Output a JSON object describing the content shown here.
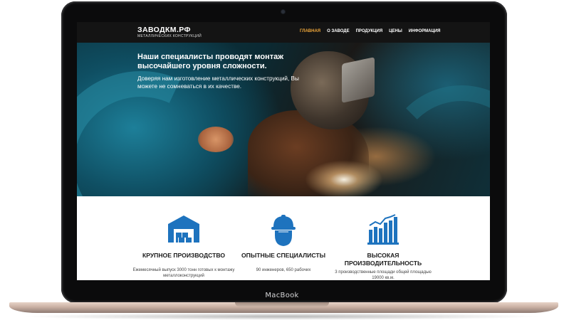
{
  "device": {
    "brand_label": "MacBook"
  },
  "nav": {
    "logo_title": "ЗАВОДКМ.РФ",
    "logo_subtitle": "МЕТАЛЛИЧЕСКИХ КОНСТРУКЦИЙ",
    "items": [
      {
        "label": "ГЛАВНАЯ",
        "active": true
      },
      {
        "label": "О ЗАВОДЕ",
        "active": false
      },
      {
        "label": "ПРОДУКЦИЯ",
        "active": false
      },
      {
        "label": "ЦЕНЫ",
        "active": false
      },
      {
        "label": "ИНФОРМАЦИЯ",
        "active": false
      }
    ]
  },
  "hero": {
    "title": "Наши специалисты проводят монтаж высочайшего уровня сложности.",
    "text": "Доверяя нам изготовление металлических конструкций, Вы можете не сомневаться в их качестве."
  },
  "features": [
    {
      "icon": "warehouse-icon",
      "title": "КРУПНОЕ ПРОИЗВОДСТВО",
      "desc": "Ежемесячный выпуск 3000 тонн готовых к монтажу металлоконструкций"
    },
    {
      "icon": "worker-helmet-icon",
      "title": "ОПЫТНЫЕ СПЕЦИАЛИСТЫ",
      "desc": "90 инженеров, 650 рабочих"
    },
    {
      "icon": "growth-chart-icon",
      "title": "ВЫСОКАЯ ПРОИЗВОДИТЕЛЬНОСТЬ",
      "desc": "3 производственные площади общей площадью 19000 кв.м."
    }
  ],
  "colors": {
    "accent": "#f2a93a",
    "icon_blue": "#1e73be",
    "nav_bg": "#141414"
  }
}
